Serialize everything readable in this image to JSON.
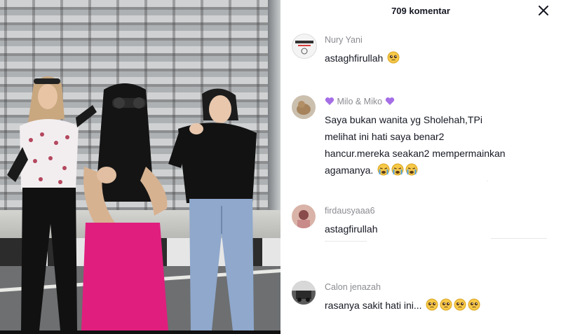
{
  "header": {
    "comment_count_label": "709 komentar",
    "close_icon": "close-icon"
  },
  "comments": [
    {
      "username": "Nury Yani",
      "text": "astaghfirullah",
      "emoji_count": 1,
      "emoji": "pleading-face"
    },
    {
      "username_prefix_emoji": "purple-heart",
      "username": "Milo & Miko",
      "username_suffix_emoji": "purple-heart",
      "text_lines": [
        "Saya bukan wanita yg Sholehah,TPi",
        "melihat ini hati saya benar2",
        "hancur.mereka seakan2 mempermainkan",
        "agamanya."
      ],
      "emoji_count": 3,
      "emoji": "loudly-crying-face"
    },
    {
      "username": "firdausyaaa6",
      "text": "astagfirullah",
      "emoji_count": 0
    },
    {
      "username": "Calon jenazah",
      "text": "rasanya sakit hati ini...",
      "emoji_count": 4,
      "emoji": "pleading-face"
    }
  ],
  "colors": {
    "text_primary": "#161823",
    "username": "#8a8b91",
    "purple_heart": "#a56ee6",
    "emoji_yellow": "#f7c948"
  }
}
